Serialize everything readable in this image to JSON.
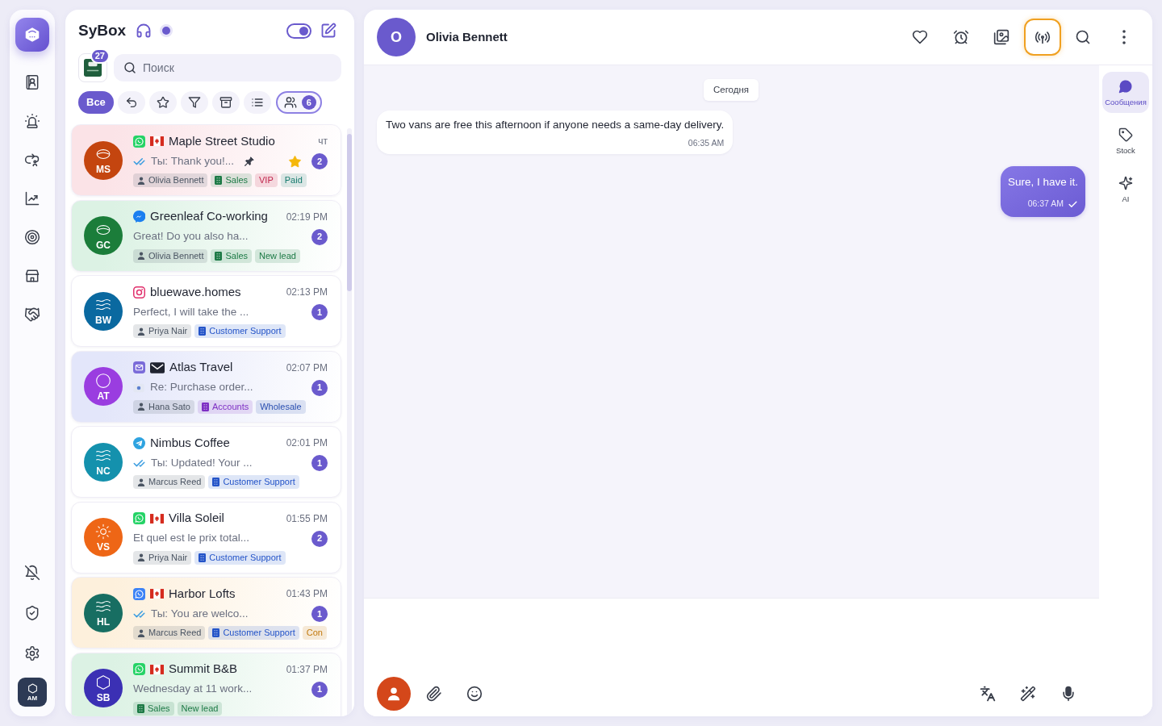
{
  "nav_rail": {
    "user_initials": "AM"
  },
  "inbox": {
    "title": "SyBox",
    "availability_toggle": {
      "on": true
    },
    "app_badge": "27",
    "search": {
      "placeholder": "Поиск"
    },
    "filters": [
      {
        "kind": "all",
        "label": "Все",
        "selected": true
      },
      {
        "kind": "replies",
        "selected": false
      },
      {
        "kind": "starred",
        "selected": false
      },
      {
        "kind": "filter",
        "selected": false
      },
      {
        "kind": "archived",
        "selected": false
      },
      {
        "kind": "list",
        "selected": false
      },
      {
        "kind": "team",
        "count": "6",
        "selected": false
      }
    ],
    "conversations": [
      {
        "avatar": {
          "initials": "MS",
          "color": "#c4450f",
          "kind": "oval"
        },
        "background": {
          "color": "#fbe3e7"
        },
        "icons": [
          {
            "kind": "phone-bubble"
          },
          {
            "kind": "flag"
          }
        ],
        "name": "Maple Street Studio",
        "time": "чт",
        "preview_icon": {
          "kind": "double-check"
        },
        "preview": "Ты: Thank you!...",
        "pinned": true,
        "starred": true,
        "unread": "2",
        "tags": [
          {
            "kind": "agent",
            "label": "Olivia Bennett",
            "color": "#4b5563"
          },
          {
            "kind": "team",
            "label": "Sales",
            "color": "#1d7a46"
          },
          {
            "kind": "label",
            "label": "VIP",
            "color": "#c0264d"
          },
          {
            "kind": "label",
            "label": "Paid",
            "color": "#167a6e"
          }
        ]
      },
      {
        "avatar": {
          "initials": "GC",
          "color": "#1b7d3a",
          "kind": "oval"
        },
        "background": {
          "color": "#dcf2e4"
        },
        "icons": [
          {
            "kind": "bolt-bubble"
          }
        ],
        "name": "Greenleaf Co-working",
        "time": "02:19 PM",
        "preview": "Great! Do you also ha...",
        "pinned": false,
        "starred": false,
        "unread": "2",
        "tags": [
          {
            "kind": "agent",
            "label": "Olivia Bennett",
            "color": "#4b5563"
          },
          {
            "kind": "team",
            "label": "Sales",
            "color": "#1d7a46"
          },
          {
            "kind": "label",
            "label": "New lead",
            "color": "#1d7a46"
          }
        ]
      },
      {
        "avatar": {
          "initials": "BW",
          "color": "#0a69a0",
          "kind": "waves"
        },
        "icons": [
          {
            "kind": "camera"
          }
        ],
        "name": "bluewave.homes",
        "time": "02:13 PM",
        "preview": "Perfect, I will take the ...",
        "pinned": false,
        "starred": false,
        "unread": "1",
        "tags": [
          {
            "kind": "agent",
            "label": "Priya Nair",
            "color": "#4b5563"
          },
          {
            "kind": "team",
            "label": "Customer Support",
            "color": "#2454c8"
          }
        ]
      },
      {
        "avatar": {
          "initials": "AT",
          "color": "#9a3de0",
          "kind": "ring"
        },
        "background": {
          "color": "#e3e6fa"
        },
        "icons": [
          {
            "kind": "envelope-tile"
          },
          {
            "kind": "envelope"
          }
        ],
        "name": "Atlas Travel",
        "time": "02:07 PM",
        "preview_icon": {
          "kind": "image"
        },
        "preview": "Re: Purchase order...",
        "pinned": false,
        "starred": false,
        "unread": "1",
        "tags": [
          {
            "kind": "agent",
            "label": "Hana Sato",
            "color": "#4b5563"
          },
          {
            "kind": "team",
            "label": "Accounts",
            "color": "#7e2fc4"
          },
          {
            "kind": "label",
            "label": "Wholesale",
            "color": "#2a4fb0"
          }
        ]
      },
      {
        "avatar": {
          "initials": "NC",
          "color": "#1491ad",
          "kind": "waves"
        },
        "icons": [
          {
            "kind": "paper-plane"
          }
        ],
        "name": "Nimbus Coffee",
        "time": "02:01 PM",
        "preview_icon": {
          "kind": "double-check"
        },
        "preview": "Ты: Updated! Your ...",
        "pinned": false,
        "starred": false,
        "unread": "1",
        "tags": [
          {
            "kind": "agent",
            "label": "Marcus Reed",
            "color": "#4b5563"
          },
          {
            "kind": "team",
            "label": "Customer Support",
            "color": "#2454c8"
          }
        ]
      },
      {
        "avatar": {
          "initials": "VS",
          "color": "#ee6616",
          "kind": "sun"
        },
        "icons": [
          {
            "kind": "phone-bubble"
          },
          {
            "kind": "flag"
          }
        ],
        "name": "Villa Soleil",
        "time": "01:55 PM",
        "preview": "Et quel est le prix total...",
        "pinned": false,
        "starred": false,
        "unread": "2",
        "tags": [
          {
            "kind": "agent",
            "label": "Priya Nair",
            "color": "#4b5563"
          },
          {
            "kind": "team",
            "label": "Customer Support",
            "color": "#2454c8"
          }
        ]
      },
      {
        "avatar": {
          "initials": "HL",
          "color": "#176e62",
          "kind": "waves"
        },
        "background": {
          "color": "#fdf0dc"
        },
        "icons": [
          {
            "kind": "phone-tile"
          },
          {
            "kind": "flag"
          }
        ],
        "name": "Harbor Lofts",
        "time": "01:43 PM",
        "preview_icon": {
          "kind": "double-check"
        },
        "preview": "Ты: You are welco...",
        "pinned": false,
        "starred": false,
        "unread": "1",
        "tags": [
          {
            "kind": "agent",
            "label": "Marcus Reed",
            "color": "#4b5563"
          },
          {
            "kind": "team",
            "label": "Customer Support",
            "color": "#2454c8"
          },
          {
            "kind": "label",
            "label": "Con",
            "color": "#c27a0e"
          }
        ]
      },
      {
        "avatar": {
          "initials": "SB",
          "color": "#3b30b4",
          "kind": "hexagon"
        },
        "background": {
          "color": "#dcf2e4"
        },
        "icons": [
          {
            "kind": "phone-bubble"
          },
          {
            "kind": "flag"
          }
        ],
        "name": "Summit B&B",
        "time": "01:37 PM",
        "preview": "Wednesday at 11 work...",
        "pinned": false,
        "starred": false,
        "unread": "1",
        "tags": [
          {
            "kind": "team",
            "label": "Sales",
            "color": "#1d7a46"
          },
          {
            "kind": "label",
            "label": "New lead",
            "color": "#1d7a46"
          }
        ]
      }
    ]
  },
  "chat": {
    "contact": {
      "initial": "O",
      "name": "Olivia Bennett"
    },
    "actions": [
      {
        "kind": "heart",
        "active": false
      },
      {
        "kind": "alarm",
        "active": false
      },
      {
        "kind": "images",
        "active": false
      },
      {
        "kind": "broadcast",
        "active": true
      },
      {
        "kind": "search",
        "active": false
      },
      {
        "kind": "more",
        "active": false
      }
    ],
    "date_divider": "Сегодня",
    "messages": [
      {
        "kind": "incoming",
        "text": "Two vans are free this afternoon if anyone needs a same-day delivery.",
        "time": "06:35 AM"
      },
      {
        "kind": "outgoing",
        "text": "Sure, I have it.",
        "time": "06:37 AM",
        "delivered": true
      }
    ],
    "side_tabs": [
      {
        "kind": "chat",
        "label": "Сообщения",
        "selected": true
      },
      {
        "kind": "tag",
        "label": "Stock",
        "selected": false
      },
      {
        "kind": "sparkles",
        "label": "AI",
        "selected": false
      }
    ]
  }
}
